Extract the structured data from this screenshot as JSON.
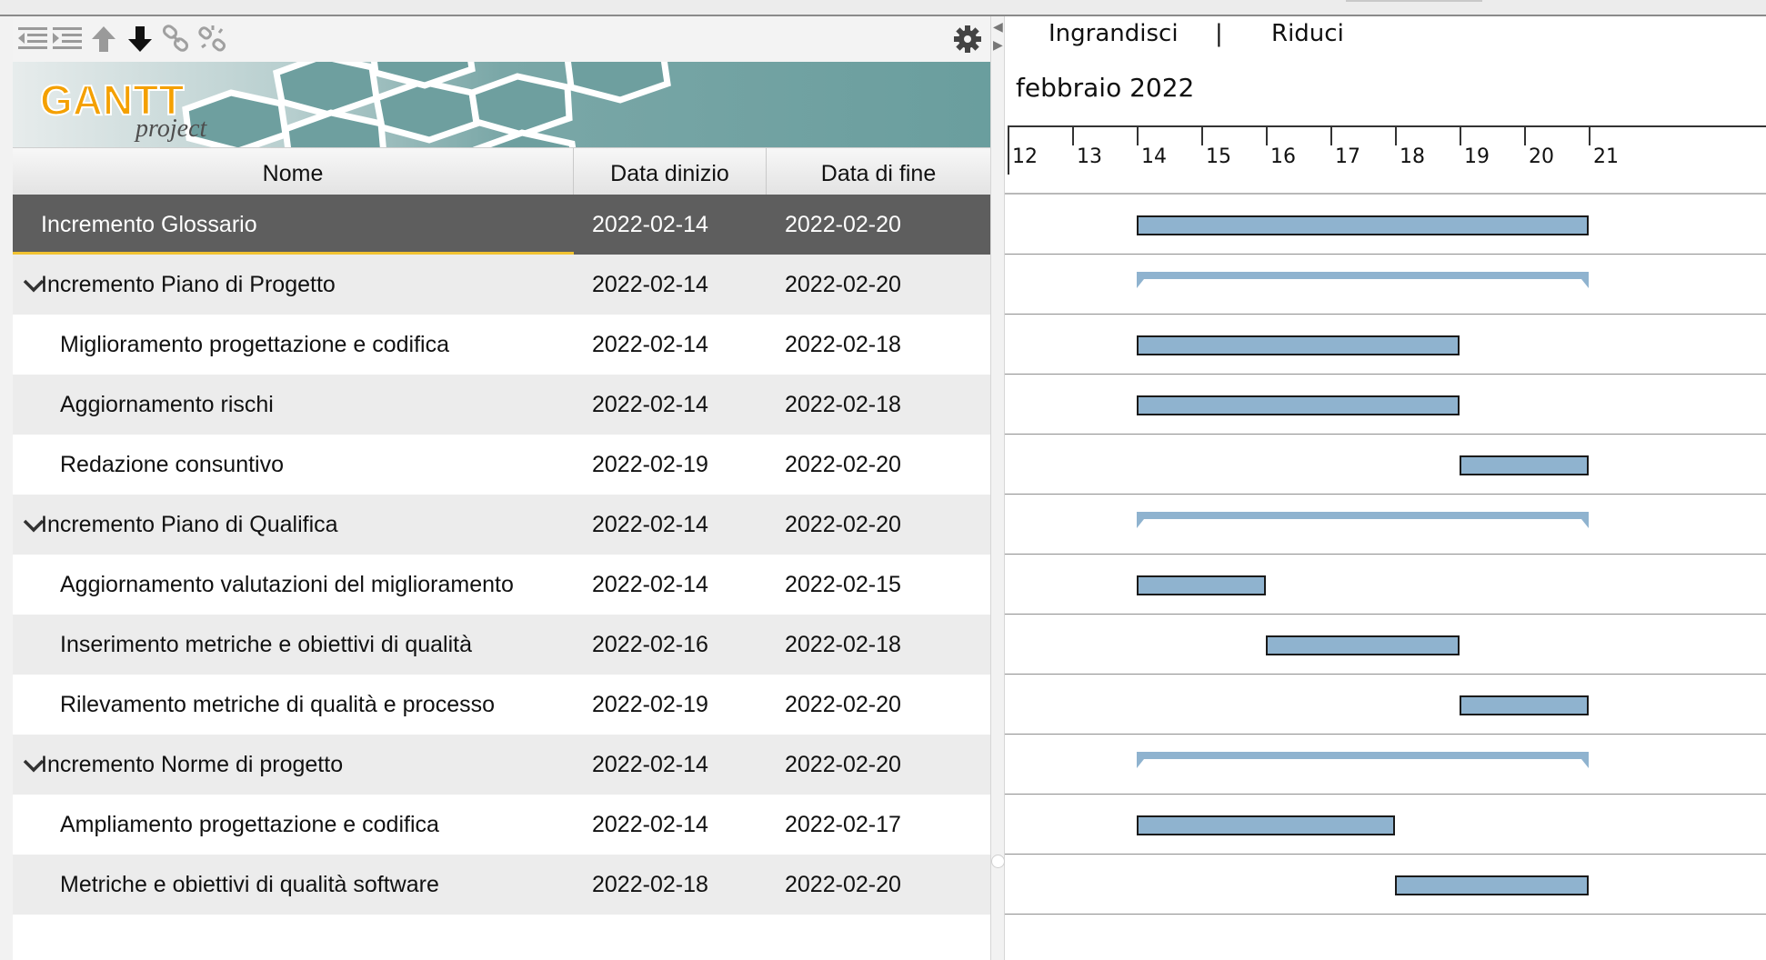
{
  "toolbar": {
    "buttons": [
      {
        "id": "unindent",
        "icon": "unindent-icon"
      },
      {
        "id": "indent",
        "icon": "indent-icon"
      },
      {
        "id": "move-up",
        "icon": "arrow-up-icon"
      },
      {
        "id": "move-down",
        "icon": "arrow-down-icon"
      },
      {
        "id": "link",
        "icon": "link-icon"
      },
      {
        "id": "unlink",
        "icon": "unlink-icon"
      }
    ],
    "settings_icon": "gear-icon"
  },
  "logo": {
    "text_main": "GANTT",
    "text_sub": "project"
  },
  "table": {
    "headers": {
      "name": "Nome",
      "start": "Data dinizio",
      "end": "Data di fine"
    },
    "rows": [
      {
        "name": "Incremento Glossario",
        "start": "2022-02-14",
        "end": "2022-02-20",
        "level": 0,
        "summary": false,
        "selected": true
      },
      {
        "name": "Incremento Piano di Progetto",
        "start": "2022-02-14",
        "end": "2022-02-20",
        "level": 0,
        "summary": true,
        "selected": false
      },
      {
        "name": "Miglioramento progettazione e codifica",
        "start": "2022-02-14",
        "end": "2022-02-18",
        "level": 1,
        "summary": false,
        "selected": false
      },
      {
        "name": "Aggiornamento rischi",
        "start": "2022-02-14",
        "end": "2022-02-18",
        "level": 1,
        "summary": false,
        "selected": false
      },
      {
        "name": "Redazione consuntivo",
        "start": "2022-02-19",
        "end": "2022-02-20",
        "level": 1,
        "summary": false,
        "selected": false
      },
      {
        "name": "Incremento Piano di Qualifica",
        "start": "2022-02-14",
        "end": "2022-02-20",
        "level": 0,
        "summary": true,
        "selected": false
      },
      {
        "name": "Aggiornamento valutazioni del miglioramento",
        "start": "2022-02-14",
        "end": "2022-02-15",
        "level": 1,
        "summary": false,
        "selected": false
      },
      {
        "name": "Inserimento metriche e obiettivi di qualità",
        "start": "2022-02-16",
        "end": "2022-02-18",
        "level": 1,
        "summary": false,
        "selected": false
      },
      {
        "name": "Rilevamento metriche di qualità e processo",
        "start": "2022-02-19",
        "end": "2022-02-20",
        "level": 1,
        "summary": false,
        "selected": false
      },
      {
        "name": "Incremento Norme di progetto",
        "start": "2022-02-14",
        "end": "2022-02-20",
        "level": 0,
        "summary": true,
        "selected": false
      },
      {
        "name": "Ampliamento progettazione e codifica",
        "start": "2022-02-14",
        "end": "2022-02-17",
        "level": 1,
        "summary": false,
        "selected": false
      },
      {
        "name": "Metriche e obiettivi di qualità software",
        "start": "2022-02-18",
        "end": "2022-02-20",
        "level": 1,
        "summary": false,
        "selected": false
      }
    ]
  },
  "chart": {
    "zoom_in": "Ingrandisci",
    "separator": "|",
    "zoom_out": "Riduci",
    "month": "febbraio 2022",
    "days": [
      "12",
      "13",
      "14",
      "15",
      "16",
      "17",
      "18",
      "19",
      "20",
      "21"
    ],
    "first_day": 12,
    "bar_color": "#8fb3cf",
    "selection_accent": "#f1c232"
  }
}
